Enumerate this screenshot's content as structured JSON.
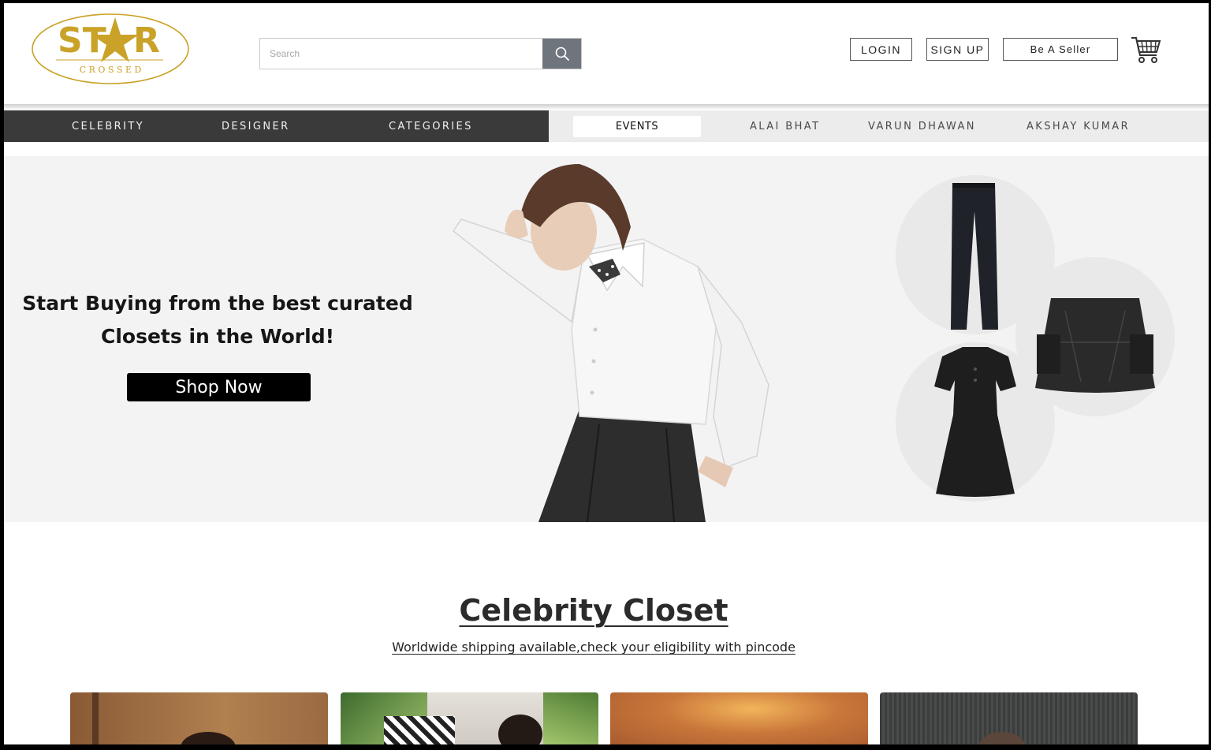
{
  "header": {
    "logo_text_top": "STAR",
    "logo_text_bottom": "C R O S S E D",
    "search": {
      "placeholder": "Search",
      "value": ""
    },
    "login_label": "LOGIN",
    "signup_label": "SIGN UP",
    "seller_label": "Be A Seller"
  },
  "nav": {
    "dark_items": [
      "CELEBRITY",
      "DESIGNER",
      "CATEGORIES"
    ],
    "active_item": "EVENTS",
    "light_items": [
      "ALAI BHAT",
      "VARUN DHAWAN",
      "AKSHAY KUMAR"
    ]
  },
  "hero": {
    "title_line1": "Start Buying from the best curated",
    "title_line2": "Closets in the World!",
    "cta_label": "Shop Now"
  },
  "section": {
    "title": "Celebrity Closet",
    "subtitle": "Worldwide shipping available,check your eligibility with pincode"
  },
  "colors": {
    "gold": "#c9a227",
    "nav_dark": "#3a3a3a",
    "nav_light": "#ececec",
    "hero_bg": "#f3f3f3",
    "search_button": "#6f757c"
  }
}
